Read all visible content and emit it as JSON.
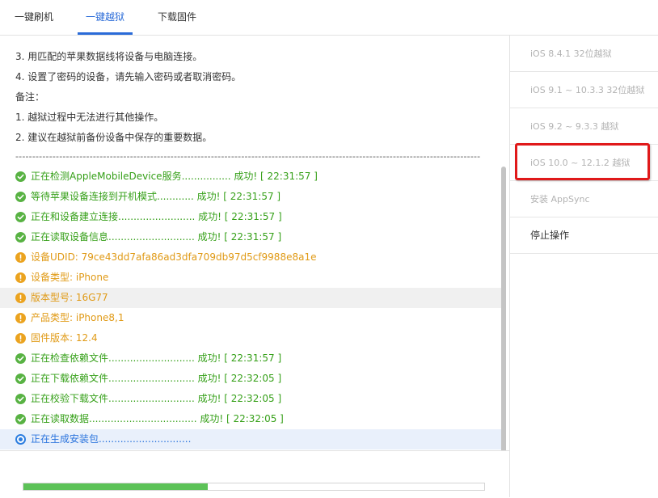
{
  "tabs": [
    {
      "label": "一键刷机",
      "active": false
    },
    {
      "label": "一键越狱",
      "active": true
    },
    {
      "label": "下载固件",
      "active": false
    }
  ],
  "notes": [
    "3. 用匹配的苹果数据线将设备与电脑连接。",
    "4. 设置了密码的设备，请先输入密码或者取消密码。",
    "备注：",
    "1. 越狱过程中无法进行其他操作。",
    "2. 建议在越狱前备份设备中保存的重要数据。"
  ],
  "divider": "-------------------------------------------------------------------------------------------------------------------------------------------------------",
  "log": [
    {
      "status": "ok",
      "text": "正在检测AppleMobileDevice服务................ 成功! [ 22:31:57 ]"
    },
    {
      "status": "ok",
      "text": "等待苹果设备连接到开机模式............ 成功! [ 22:31:57 ]"
    },
    {
      "status": "ok",
      "text": "正在和设备建立连接......................... 成功! [ 22:31:57 ]"
    },
    {
      "status": "ok",
      "text": "正在读取设备信息............................ 成功! [ 22:31:57 ]"
    },
    {
      "status": "warn",
      "text": "设备UDID: 79ce43dd7afa86ad3dfa709db97d5cf9988e8a1e"
    },
    {
      "status": "warn",
      "text": "设备类型: iPhone"
    },
    {
      "status": "warn",
      "text": "版本型号: 16G77"
    },
    {
      "status": "warn",
      "text": "产品类型: iPhone8,1"
    },
    {
      "status": "warn",
      "text": "固件版本: 12.4"
    },
    {
      "status": "ok",
      "text": "正在检查依赖文件............................ 成功! [ 22:31:57 ]"
    },
    {
      "status": "ok",
      "text": "正在下载依赖文件............................ 成功! [ 22:32:05 ]"
    },
    {
      "status": "ok",
      "text": "正在校验下载文件............................ 成功! [ 22:32:05 ]"
    },
    {
      "status": "ok",
      "text": "正在读取数据................................... 成功! [ 22:32:05 ]"
    },
    {
      "status": "busy",
      "text": "正在生成安装包.............................."
    }
  ],
  "progress": 0.4,
  "sidebar": {
    "items": [
      {
        "label": "iOS 8.4.1 32位越狱"
      },
      {
        "label": "iOS 9.1 ~ 10.3.3 32位越狱"
      },
      {
        "label": "iOS 9.2 ~ 9.3.3 越狱"
      },
      {
        "label": "iOS 10.0 ~ 12.1.2 越狱"
      },
      {
        "label": "安装 AppSync"
      },
      {
        "label": "停止操作"
      }
    ]
  },
  "colors": {
    "accent": "#2a6bd8",
    "success": "#36a019",
    "warning": "#e09a16",
    "highlight_box": "#e0191a",
    "progress": "#5cc257"
  },
  "icons": {
    "ok": "check-circle-icon",
    "warn": "exclamation-circle-icon",
    "busy": "loading-circle-icon"
  }
}
